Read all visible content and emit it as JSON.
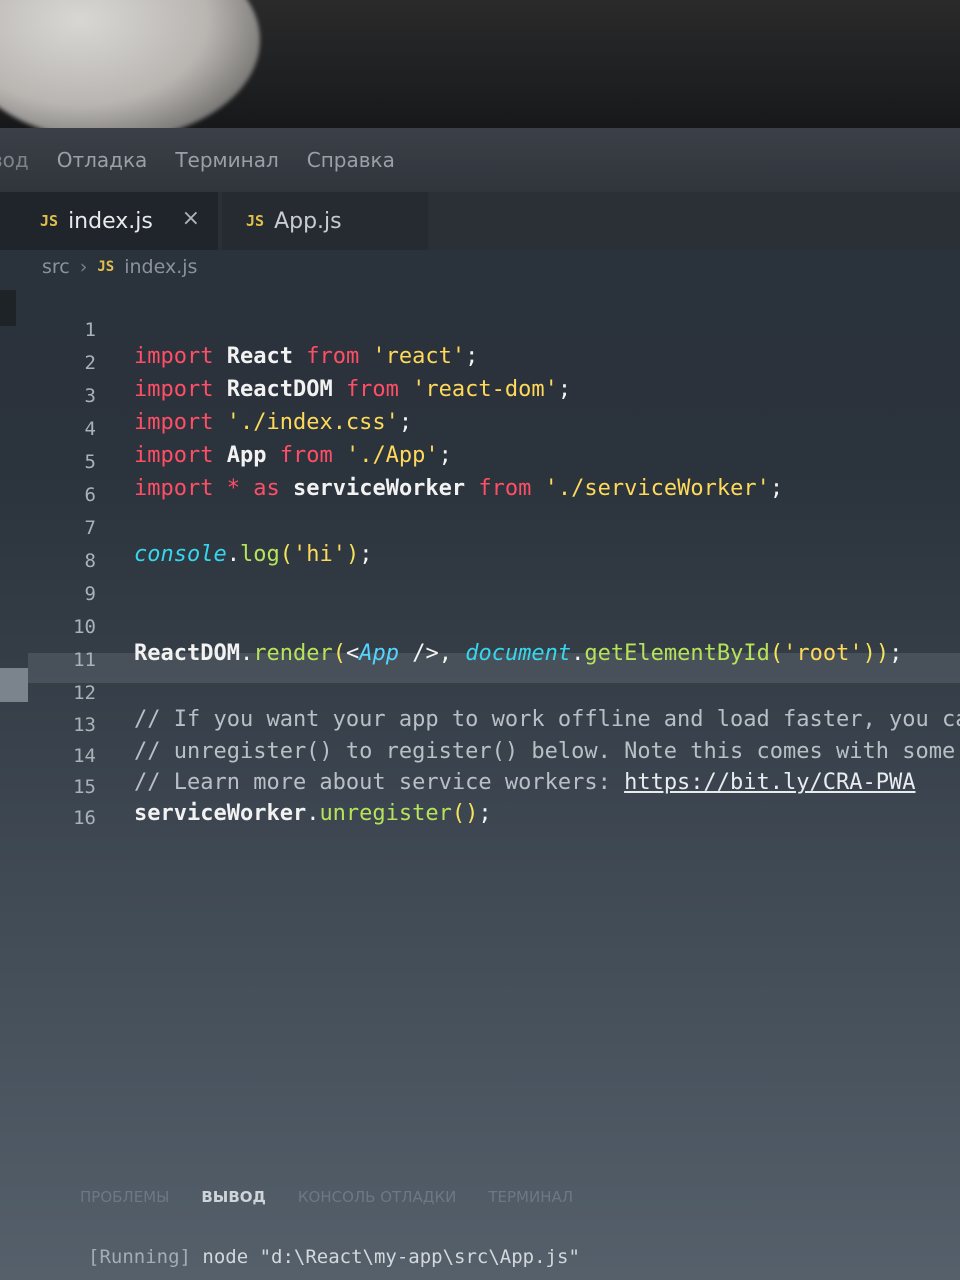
{
  "menu": [
    "зод",
    "Отладка",
    "Терминал",
    "Справка"
  ],
  "tabs": [
    {
      "icon": "JS",
      "label": "index.js",
      "close": "×"
    },
    {
      "icon": "JS",
      "label": "App.js"
    }
  ],
  "breadcrumb": {
    "folder": "src",
    "icon": "JS",
    "file": "index.js"
  },
  "editor": {
    "line_numbers": [
      "1",
      "2",
      "3",
      "4",
      "5",
      "6",
      "7",
      "8",
      "9",
      "10",
      "11",
      "12",
      "13",
      "14",
      "15",
      "16"
    ],
    "l1": {
      "a": "import",
      "b": " React ",
      "c": "from",
      "d": " 'react'",
      "e": ";"
    },
    "l2": {
      "a": "import",
      "b": " ReactDOM ",
      "c": "from",
      "d": " 'react-dom'",
      "e": ";"
    },
    "l3": {
      "a": "import",
      "d": " './index.css'",
      "e": ";"
    },
    "l4": {
      "a": "import",
      "b": " App ",
      "c": "from",
      "d": " './App'",
      "e": ";"
    },
    "l5": {
      "a": "import",
      "s": " * ",
      "k": "as",
      "b": " serviceWorker ",
      "c": "from",
      "d": " './serviceWorker'",
      "e": ";"
    },
    "l7": {
      "a": "console",
      "dot": ".",
      "m": "log",
      "p1": "(",
      "s": "'hi'",
      "p2": ")",
      "e": ";"
    },
    "l10": {
      "a": "ReactDOM",
      "dot": ".",
      "m": "render",
      "p1": "(",
      "lt": "<",
      "tag": "App",
      "sl": " />",
      "c": ", ",
      "doc": "document",
      "dot2": ".",
      "m2": "getElementById",
      "p2": "(",
      "s": "'root'",
      "p3": "))",
      "e": ";"
    },
    "l12": "// If you want your app to work offline and load faster, you can",
    "l13": "// unregister() to register() below. Note this comes with some p",
    "l14a": "// Learn more about service workers: ",
    "l14b": "https://bit.ly/CRA-PWA",
    "l15": {
      "a": "serviceWorker",
      "dot": ".",
      "m": "unregister",
      "p": "()",
      "e": ";"
    }
  },
  "panel": {
    "tabs": [
      "ПРОБЛЕМЫ",
      "ВЫВОД",
      "КОНСОЛЬ ОТЛАДКИ",
      "ТЕРМИНАЛ"
    ],
    "active_tab": "ВЫВОД",
    "output_tag": "[Running]",
    "output_cmd": " node \"d:\\React\\my-app\\src\\App.js\""
  }
}
